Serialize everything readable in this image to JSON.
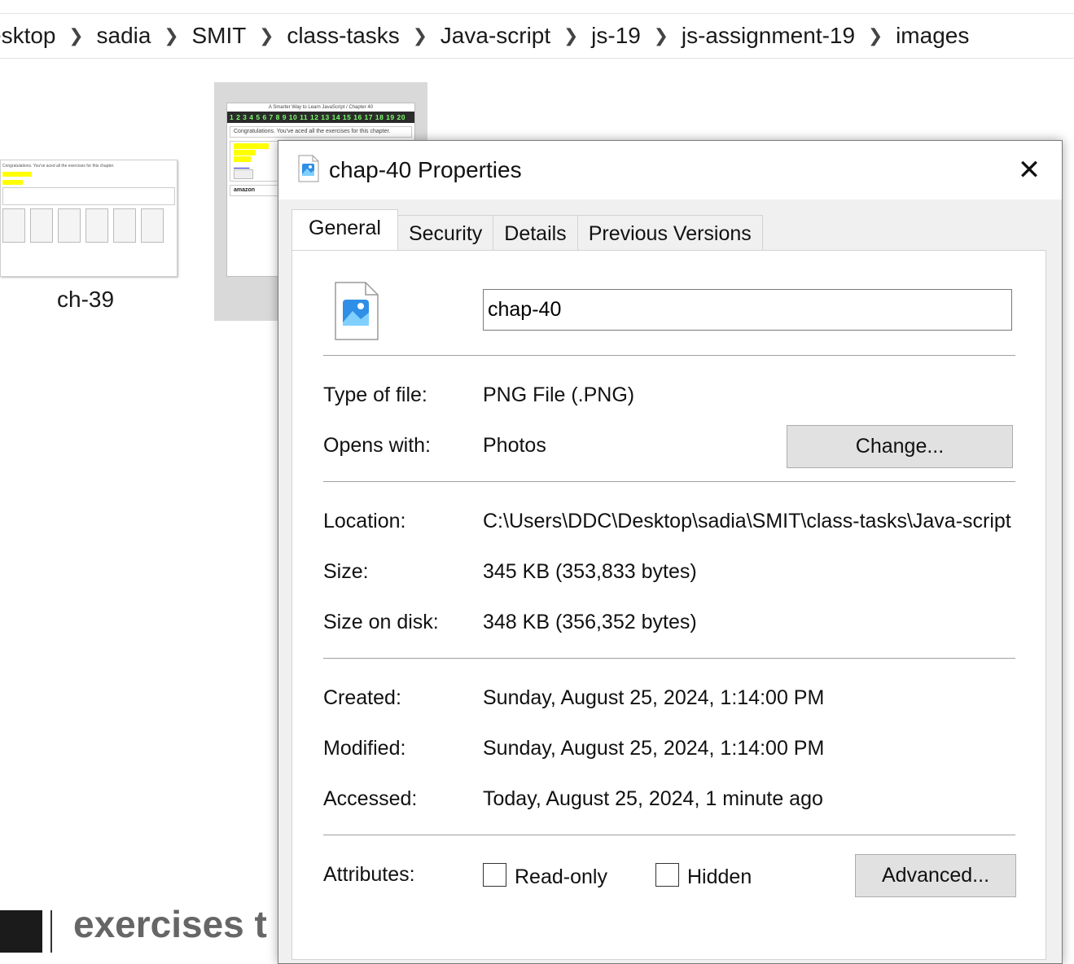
{
  "explorer": {
    "breadcrumb": [
      "esktop",
      "sadia",
      "SMIT",
      "class-tasks",
      "Java-script",
      "js-19",
      "js-assignment-19",
      "images"
    ],
    "file1_label": "ch-39",
    "thumb_chapter_header": "A Smarter Way to Learn JavaScript / Chapter 40",
    "thumb_numbers": "1 2 3 4 5 6 7 8 9 10 11 12 13 14 15 16 17 18 19 20",
    "thumb_congrats": "Congratulations. You've aced all the exercises for this chapter.",
    "thumb_amazon": "amazon",
    "bottom_text": "exercises t"
  },
  "dialog": {
    "title": "chap-40 Properties",
    "close_symbol": "✕",
    "tabs": [
      "General",
      "Security",
      "Details",
      "Previous Versions"
    ],
    "active_tab": "General",
    "file_name": "chap-40",
    "type_label": "Type of file:",
    "type_value": "PNG File (.PNG)",
    "opens_label": "Opens with:",
    "opens_value": "Photos",
    "change_button": "Change...",
    "location_label": "Location:",
    "location_value": "C:\\Users\\DDC\\Desktop\\sadia\\SMIT\\class-tasks\\Java-script",
    "size_label": "Size:",
    "size_value": "345 KB (353,833 bytes)",
    "size_disk_label": "Size on disk:",
    "size_disk_value": "348 KB (356,352 bytes)",
    "created_label": "Created:",
    "created_value": "Sunday, August 25, 2024, 1:14:00 PM",
    "modified_label": "Modified:",
    "modified_value": "Sunday, August 25, 2024, 1:14:00 PM",
    "accessed_label": "Accessed:",
    "accessed_value": "Today, August 25, 2024, 1 minute ago",
    "attributes_label": "Attributes:",
    "readonly_label": "Read-only",
    "hidden_label": "Hidden",
    "advanced_button": "Advanced...",
    "readonly_checked": false,
    "hidden_checked": false
  },
  "colors": {
    "accent_icon": "#2f8ee8",
    "dialog_bg": "#f0f0f0",
    "button_bg": "#e1e1e1"
  }
}
